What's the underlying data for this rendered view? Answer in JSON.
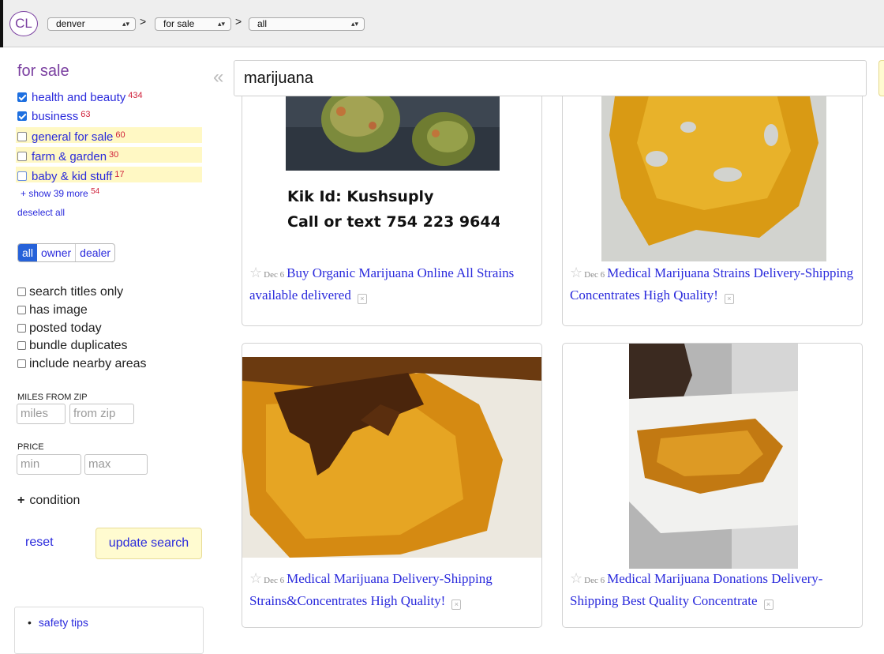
{
  "topbar": {
    "logo": "CL",
    "location": "denver",
    "section": "for sale",
    "category": "all",
    "separator": ">",
    "arrows": "▴▾"
  },
  "sidebar": {
    "title": "for sale",
    "categories": [
      {
        "label": "health and beauty",
        "count": "434",
        "checked": true
      },
      {
        "label": "business",
        "count": "63",
        "checked": true
      },
      {
        "label": "general for sale",
        "count": "60",
        "checked": false
      },
      {
        "label": "farm & garden",
        "count": "30",
        "checked": false
      },
      {
        "label": "baby & kid stuff",
        "count": "17",
        "checked": false
      }
    ],
    "show_more": "+ show 39 more",
    "show_more_count": "54",
    "deselect_all": "deselect all",
    "seller_filter": {
      "all": "all",
      "owner": "owner",
      "dealer": "dealer",
      "selected": "all"
    },
    "options": {
      "search_titles_only": "search titles only",
      "has_image": "has image",
      "posted_today": "posted today",
      "bundle_duplicates": "bundle duplicates",
      "include_nearby_areas": "include nearby areas"
    },
    "miles_label": "MILES FROM ZIP",
    "miles_placeholder": "miles",
    "zip_placeholder": "from zip",
    "price_label": "PRICE",
    "min_placeholder": "min",
    "max_placeholder": "max",
    "condition_plus": "+",
    "condition": "condition",
    "reset": "reset",
    "update_search": "update search",
    "safety_tips": "safety tips"
  },
  "search": {
    "collapse": "«",
    "query": "marijuana"
  },
  "listings": [
    {
      "star": "☆",
      "date": "Dec 6",
      "title": "Buy Organic Marijuana Online All Strains available delivered",
      "hide": "×",
      "image_text_1": "Kik Id:  Kushsuply",
      "image_text_2": "Call or text 754 223 9644"
    },
    {
      "star": "☆",
      "date": "Dec 6",
      "title": "Medical Marijuana Strains Delivery-Shipping Concentrates High Quality!",
      "hide": "×"
    },
    {
      "star": "☆",
      "date": "Dec 6",
      "title": "Medical Marijuana Delivery-Shipping Strains&Concentrates High Quality!",
      "hide": "×"
    },
    {
      "star": "☆",
      "date": "Dec 6",
      "title": "Medical Marijuana Donations Delivery-Shipping Best Quality Concentrate",
      "hide": "×"
    }
  ]
}
